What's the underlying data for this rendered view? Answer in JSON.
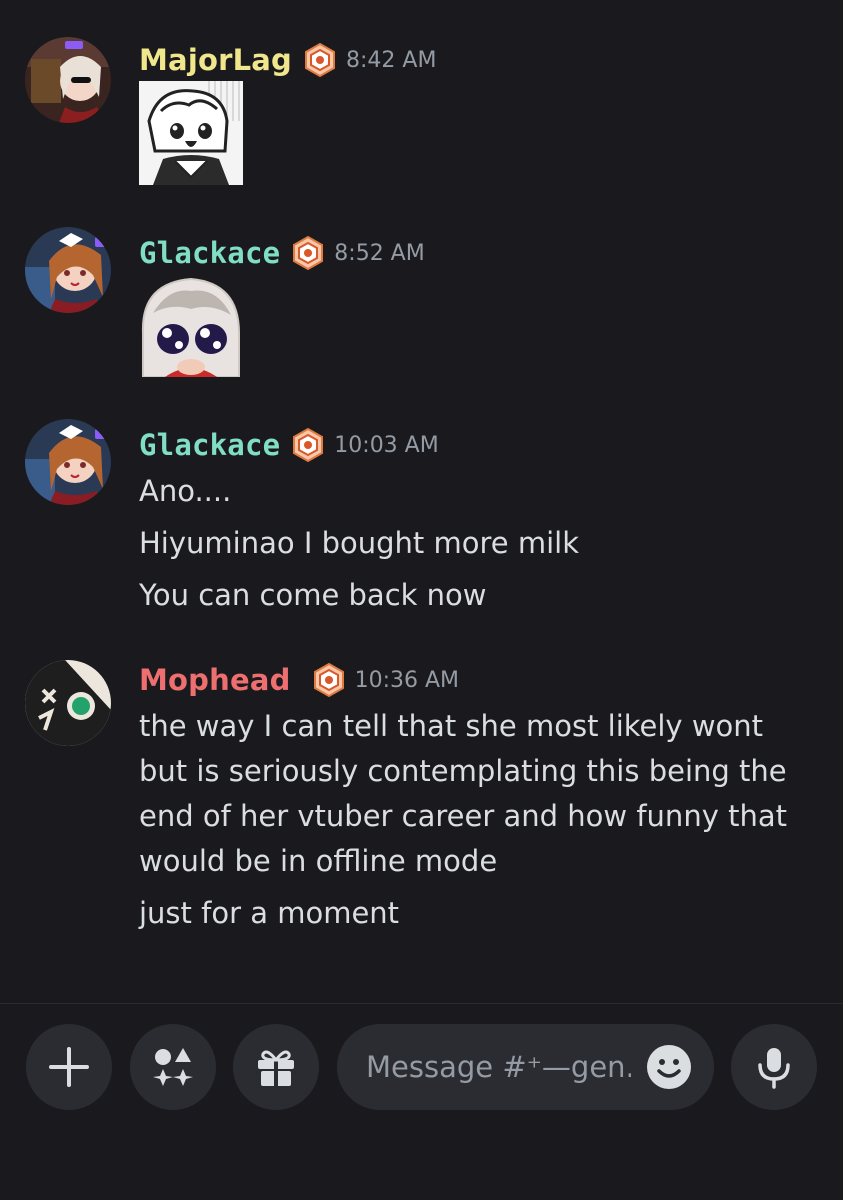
{
  "messages": [
    {
      "author": "MajorLag",
      "author_color": "#f0e68c",
      "time": "8:42 AM",
      "content_type": "sticker",
      "sticker_icon": "manga-girl-sticker"
    },
    {
      "author": "Glackace",
      "author_color": "#7fdec3",
      "time": "8:52 AM",
      "content_type": "sticker",
      "sticker_icon": "crying-girl-sticker"
    },
    {
      "author": "Glackace",
      "author_color": "#7fdec3",
      "time": "10:03 AM",
      "content_type": "text",
      "lines": [
        "Ano....",
        "Hiyuminao I bought more milk",
        "You can come back now"
      ]
    },
    {
      "author": "Mophead",
      "author_color": "#ee6f6f",
      "time": "10:36 AM",
      "content_type": "text",
      "paragraph_lines": [
        "the way I can tell that she most likely wont",
        "but is seriously contemplating this being the",
        "end of her vtuber career and how funny that",
        "would be in offline mode"
      ],
      "followup": "just for a moment"
    }
  ],
  "composer": {
    "placeholder": "Message #⁺—gen...",
    "buttons": [
      "plus-icon",
      "apps-icon",
      "gift-icon",
      "emoji-icon",
      "microphone-icon"
    ]
  },
  "colors": {
    "background": "#1a1a1e",
    "text": "#dbdee1",
    "muted": "#949ba4",
    "pill": "#2b2c31"
  }
}
